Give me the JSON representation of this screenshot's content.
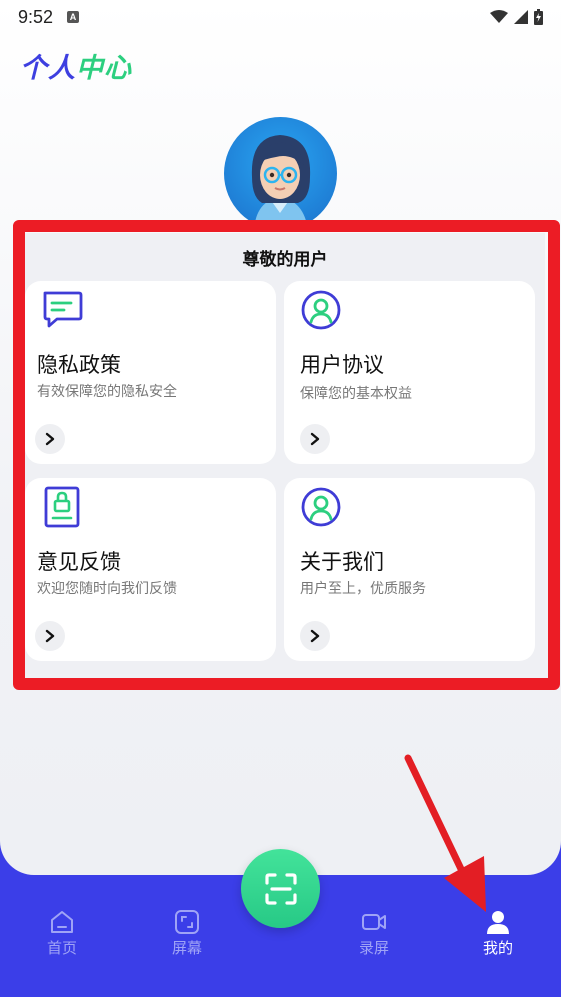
{
  "status_bar": {
    "time": "9:52",
    "notification_letter": "A"
  },
  "app_title": {
    "part1": "个人",
    "part2": "中心"
  },
  "section": {
    "title": "尊敬的用户"
  },
  "cards": [
    {
      "title": "隐私政策",
      "subtitle": "有效保障您的隐私安全",
      "icon": "chat-bubble-icon"
    },
    {
      "title": "用户协议",
      "subtitle": "保障您的基本权益",
      "icon": "user-circle-icon"
    },
    {
      "title": "意见反馈",
      "subtitle": "欢迎您随时向我们反馈",
      "icon": "lock-document-icon"
    },
    {
      "title": "关于我们",
      "subtitle": "用户至上，优质服务",
      "icon": "user-circle-icon"
    }
  ],
  "nav": [
    {
      "label": "首页",
      "icon": "home-icon",
      "active": false
    },
    {
      "label": "屏幕",
      "icon": "screen-icon",
      "active": false
    },
    {
      "label": "录屏",
      "icon": "video-camera-icon",
      "active": false
    },
    {
      "label": "我的",
      "icon": "person-icon",
      "active": true
    }
  ],
  "colors": {
    "brand_blue": "#3b3ee8",
    "brand_green": "#2ccf7f",
    "highlight_red": "#ec1c25",
    "icon_purple": "#3f3cd6"
  }
}
